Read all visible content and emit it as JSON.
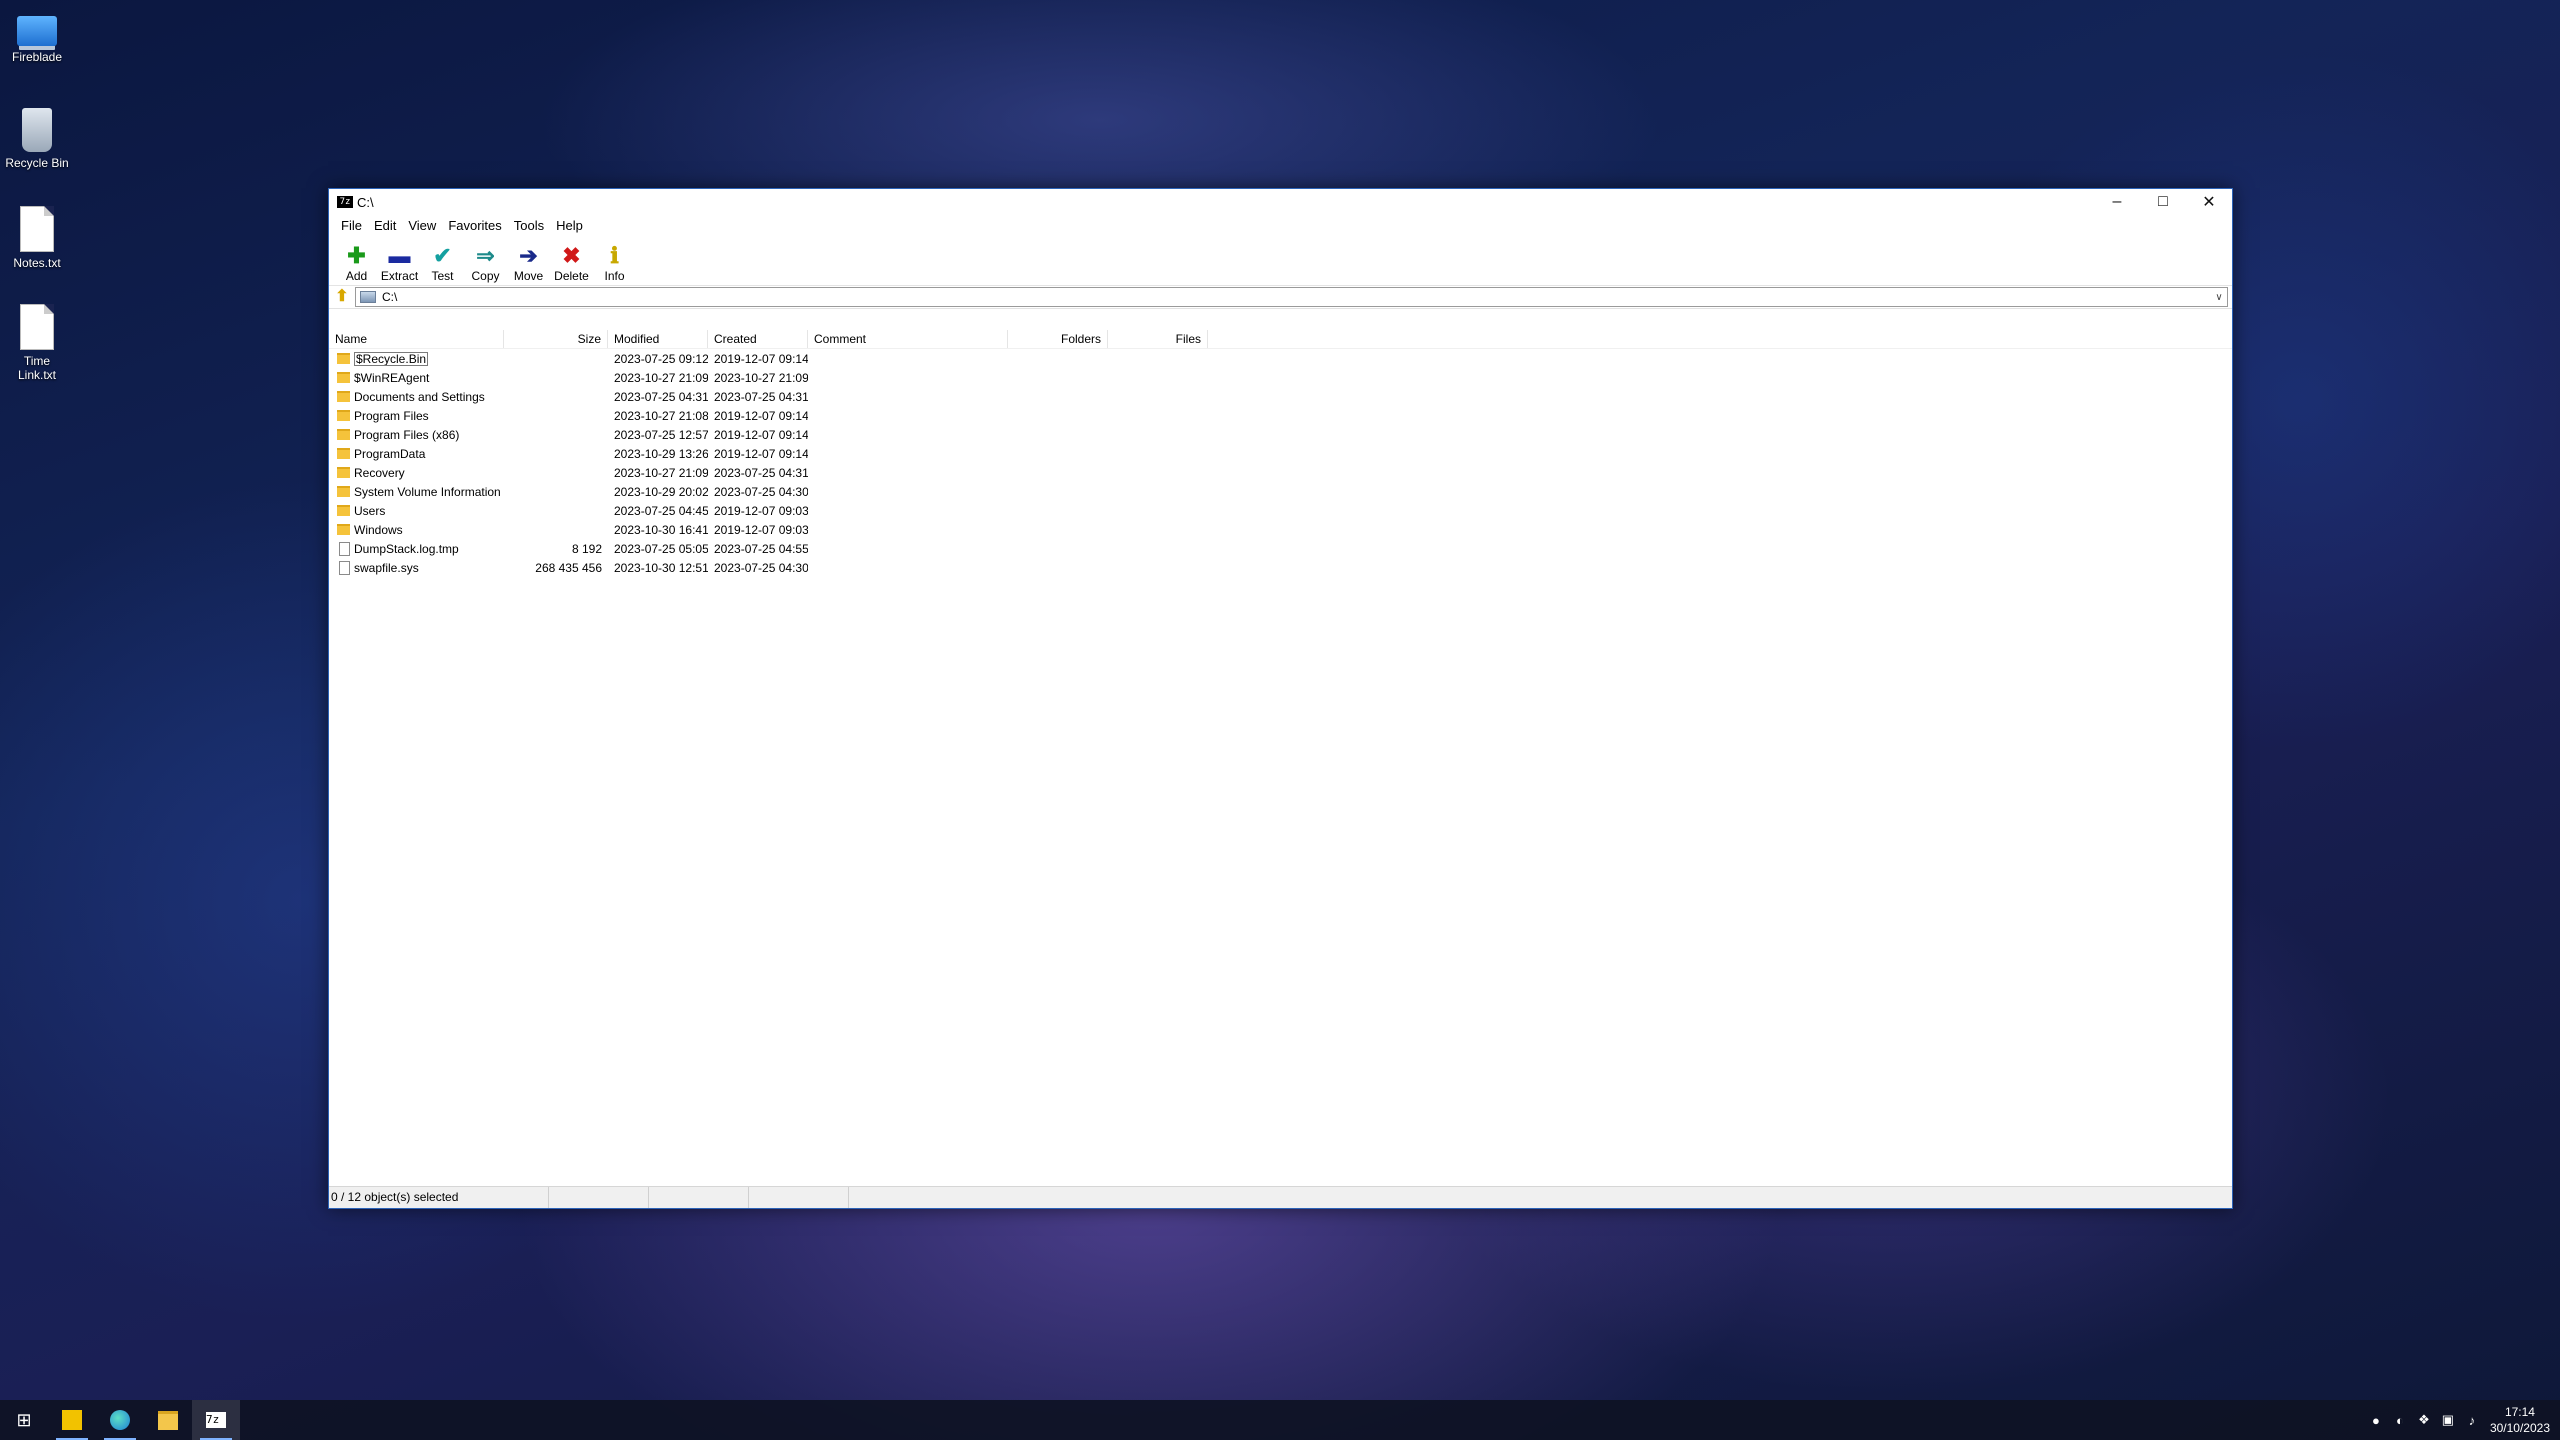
{
  "desktop": {
    "icons": [
      {
        "label": "Fireblade",
        "icon": "computer-icon"
      },
      {
        "label": "Recycle Bin",
        "icon": "recycle-bin-icon"
      },
      {
        "label": "Notes.txt",
        "icon": "text-file-icon"
      },
      {
        "label": "Time Link.txt",
        "icon": "text-file-icon"
      }
    ]
  },
  "window": {
    "title": "C:\\",
    "app_icon_text": "7z",
    "menu": [
      "File",
      "Edit",
      "View",
      "Favorites",
      "Tools",
      "Help"
    ],
    "toolbar": [
      {
        "label": "Add",
        "icon": "plus-icon",
        "color": "#1a9a1a"
      },
      {
        "label": "Extract",
        "icon": "minus-icon",
        "color": "#1a2aa0"
      },
      {
        "label": "Test",
        "icon": "check-icon",
        "color": "#14a0a0"
      },
      {
        "label": "Copy",
        "icon": "double-arrow-icon",
        "color": "#1d8a8a"
      },
      {
        "label": "Move",
        "icon": "arrow-right-icon",
        "color": "#1a2a8a"
      },
      {
        "label": "Delete",
        "icon": "x-icon",
        "color": "#d01818"
      },
      {
        "label": "Info",
        "icon": "info-icon",
        "color": "#c8a800"
      }
    ],
    "address": "C:\\",
    "columns": [
      "Name",
      "Size",
      "Modified",
      "Created",
      "Comment",
      "Folders",
      "Files"
    ],
    "rows": [
      {
        "name": "$Recycle.Bin",
        "type": "folder",
        "size": "",
        "modified": "2023-07-25 09:12",
        "created": "2019-12-07 09:14"
      },
      {
        "name": "$WinREAgent",
        "type": "folder",
        "size": "",
        "modified": "2023-10-27 21:09",
        "created": "2023-10-27 21:09"
      },
      {
        "name": "Documents and Settings",
        "type": "folder",
        "size": "",
        "modified": "2023-07-25 04:31",
        "created": "2023-07-25 04:31"
      },
      {
        "name": "Program Files",
        "type": "folder",
        "size": "",
        "modified": "2023-10-27 21:08",
        "created": "2019-12-07 09:14"
      },
      {
        "name": "Program Files (x86)",
        "type": "folder",
        "size": "",
        "modified": "2023-07-25 12:57",
        "created": "2019-12-07 09:14"
      },
      {
        "name": "ProgramData",
        "type": "folder",
        "size": "",
        "modified": "2023-10-29 13:26",
        "created": "2019-12-07 09:14"
      },
      {
        "name": "Recovery",
        "type": "folder",
        "size": "",
        "modified": "2023-10-27 21:09",
        "created": "2023-07-25 04:31"
      },
      {
        "name": "System Volume Information",
        "type": "folder",
        "size": "",
        "modified": "2023-10-29 20:02",
        "created": "2023-07-25 04:30"
      },
      {
        "name": "Users",
        "type": "folder",
        "size": "",
        "modified": "2023-07-25 04:45",
        "created": "2019-12-07 09:03"
      },
      {
        "name": "Windows",
        "type": "folder",
        "size": "",
        "modified": "2023-10-30 16:41",
        "created": "2019-12-07 09:03"
      },
      {
        "name": "DumpStack.log.tmp",
        "type": "file",
        "size": "8 192",
        "modified": "2023-07-25 05:05",
        "created": "2023-07-25 04:55"
      },
      {
        "name": "swapfile.sys",
        "type": "file",
        "size": "268 435 456",
        "modified": "2023-10-30 12:51",
        "created": "2023-07-25 04:30"
      }
    ],
    "status": "0 / 12 object(s) selected"
  },
  "taskbar": {
    "items": [
      "start-icon",
      "sticky-app-icon",
      "edge-icon",
      "file-explorer-icon",
      "7zip-icon"
    ],
    "time": "17:14",
    "date": "30/10/2023"
  }
}
